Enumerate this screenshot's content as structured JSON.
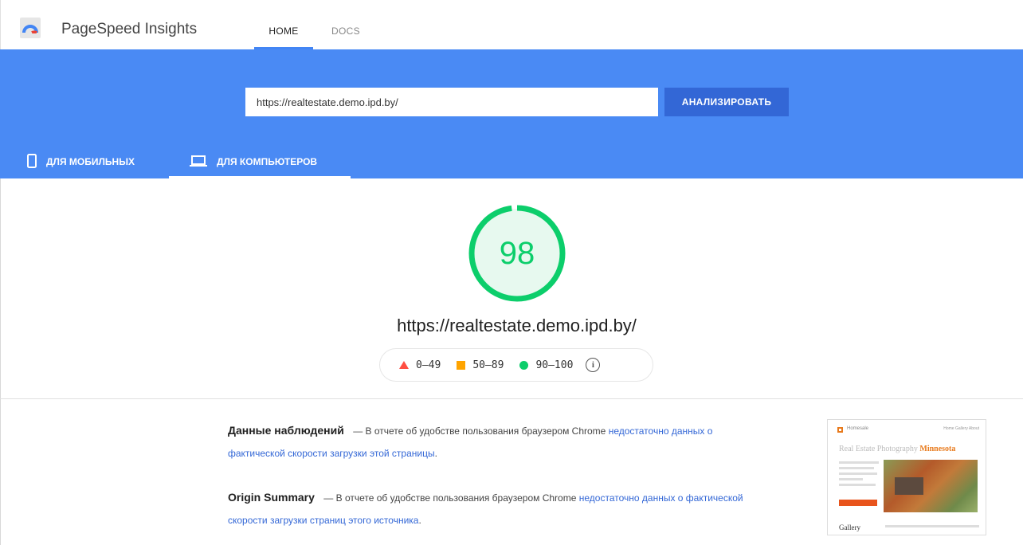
{
  "app": {
    "title": "PageSpeed Insights"
  },
  "nav": {
    "home": "HOME",
    "docs": "DOCS"
  },
  "search": {
    "url": "https://realtestate.demo.ipd.by/",
    "analyze_label": "АНАЛИЗИРОВАТЬ"
  },
  "device_tabs": {
    "mobile": "ДЛЯ МОБИЛЬНЫХ",
    "desktop": "ДЛЯ КОМПЬЮТЕРОВ",
    "selected": "desktop"
  },
  "score": {
    "value": "98",
    "fraction": 0.98,
    "color": "#0cce6b"
  },
  "tested_url": "https://realtestate.demo.ipd.by/",
  "legend": {
    "fail": "0–49",
    "average": "50–89",
    "pass": "90–100"
  },
  "field_data": {
    "heading": "Данные наблюдений",
    "text": "— В отчете об удобстве пользования браузером Chrome",
    "link": "недостаточно данных о фактической скорости загрузки этой страницы",
    "end": "."
  },
  "origin_summary": {
    "heading": "Origin Summary",
    "text": "— В отчете об удобстве пользования браузером Chrome",
    "link": "недостаточно данных о фактической скорости загрузки страниц этого источника",
    "end": "."
  },
  "thumbnail": {
    "brand": "Homesale",
    "nav": "Home  Gallery  About",
    "title_part1": "Real Estate Photography",
    "title_part2": "Minnesota",
    "section": "Gallery"
  },
  "colors": {
    "header_blue": "#4a8af4",
    "button_blue": "#3367d6",
    "fail": "#ff4e42",
    "average": "#ffa400",
    "pass": "#0cce6b"
  }
}
